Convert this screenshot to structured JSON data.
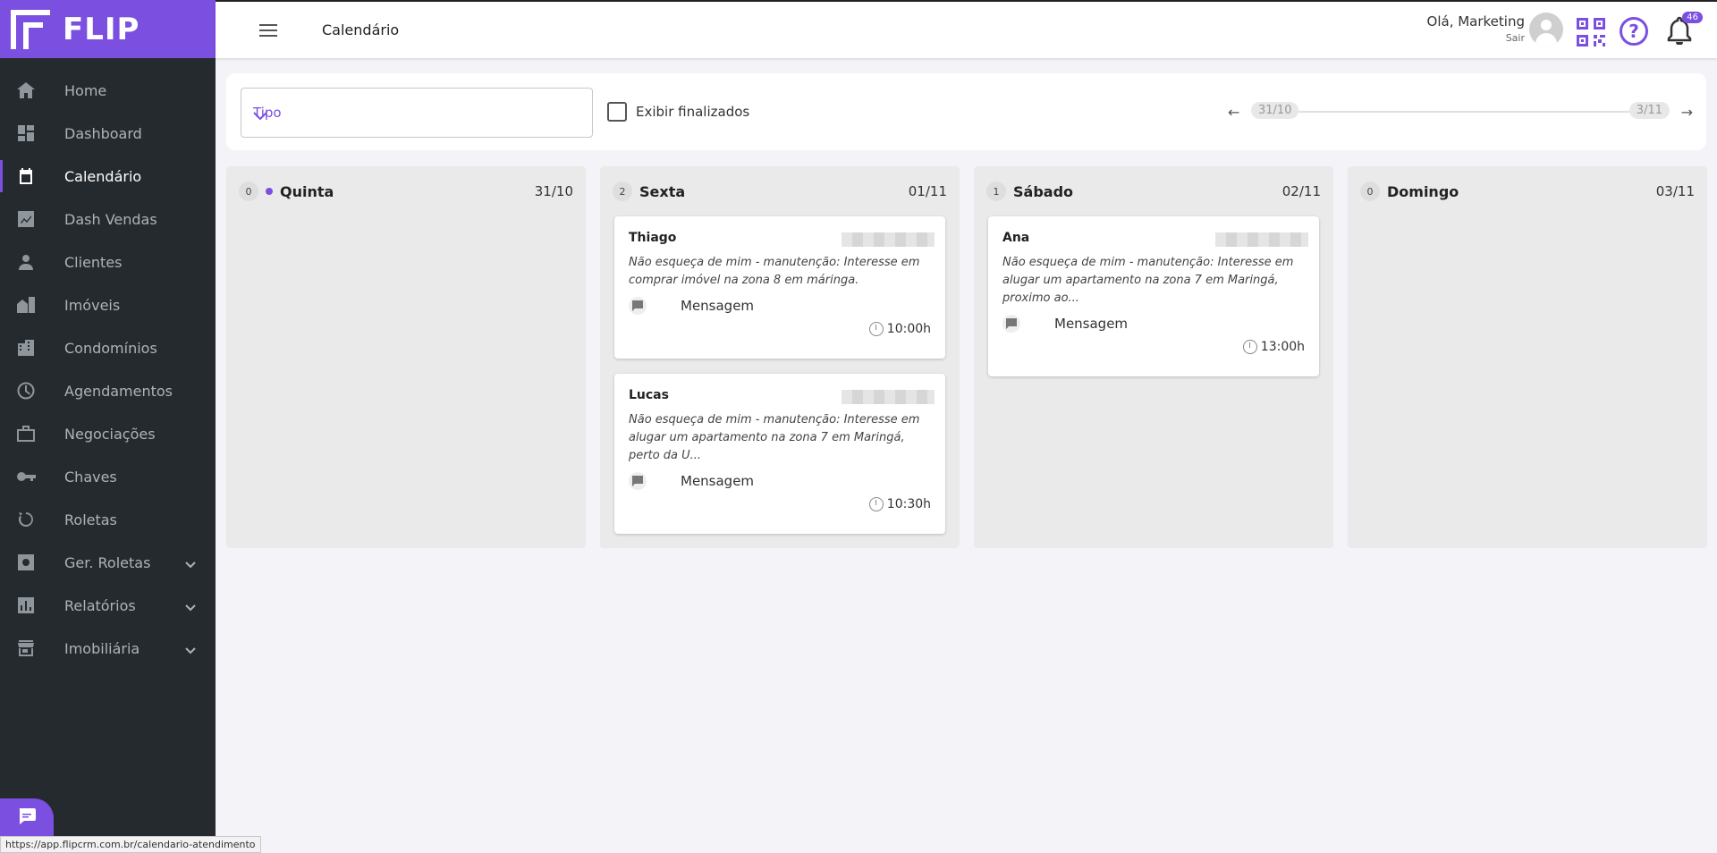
{
  "brand": {
    "name": "FLIP"
  },
  "sidebar": {
    "items": [
      {
        "label": "Home",
        "icon": "home-icon"
      },
      {
        "label": "Dashboard",
        "icon": "dashboard-icon"
      },
      {
        "label": "Calendário",
        "icon": "calendar-icon",
        "active": true
      },
      {
        "label": "Dash Vendas",
        "icon": "chart-icon"
      },
      {
        "label": "Clientes",
        "icon": "person-icon"
      },
      {
        "label": "Imóveis",
        "icon": "building-icon"
      },
      {
        "label": "Condomínios",
        "icon": "apartment-icon"
      },
      {
        "label": "Agendamentos",
        "icon": "clock-icon"
      },
      {
        "label": "Negociações",
        "icon": "briefcase-icon"
      },
      {
        "label": "Chaves",
        "icon": "key-icon"
      },
      {
        "label": "Roletas",
        "icon": "roulette-icon"
      },
      {
        "label": "Ger. Roletas",
        "icon": "settings-box-icon"
      },
      {
        "label": "Relatórios",
        "icon": "bar-report-icon"
      },
      {
        "label": "Imobiliária",
        "icon": "store-icon"
      }
    ]
  },
  "status_url": "https://app.flipcrm.com.br/calendario-atendimento",
  "header": {
    "title": "Calendário",
    "greeting": "Olá, Marketing",
    "logout": "Sair",
    "help": "?",
    "notifications": "46"
  },
  "filters": {
    "type_placeholder": "Tipo",
    "show_finished": "Exibir finalizados",
    "range_start": "31/10",
    "range_end": "3/11"
  },
  "columns": [
    {
      "count": "0",
      "day": "Quinta",
      "date": "31/10",
      "cards": []
    },
    {
      "count": "2",
      "day": "Sexta",
      "date": "01/11",
      "cards": [
        {
          "name": "Thiago",
          "desc": "Não esqueça de mim - manutenção: Interesse em comprar imóvel na zona 8 em máringa.",
          "msg": "Mensagem",
          "time": "10:00h"
        },
        {
          "name": "Lucas",
          "desc": "Não esqueça de mim - manutenção: Interesse em alugar um apartamento na zona 7 em Maringá, perto da U...",
          "msg": "Mensagem",
          "time": "10:30h"
        }
      ]
    },
    {
      "count": "1",
      "day": "Sábado",
      "date": "02/11",
      "cards": [
        {
          "name": "Ana",
          "desc": "Não esqueça de mim - manutenção: Interesse em alugar um apartamento na zona 7 em Maringá, proximo ao...",
          "msg": "Mensagem",
          "time": "13:00h"
        }
      ]
    },
    {
      "count": "0",
      "day": "Domingo",
      "date": "03/11",
      "cards": []
    }
  ],
  "colors": {
    "accent": "#7b4fe0",
    "sidebar": "#252a2e"
  }
}
